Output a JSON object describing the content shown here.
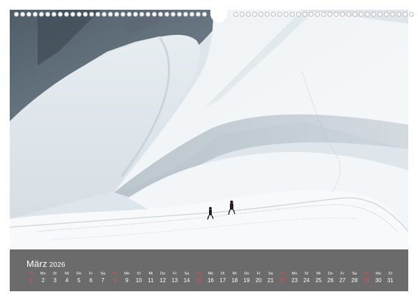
{
  "calendar": {
    "month": "März",
    "year": "2026",
    "days": [
      {
        "dow": "So",
        "num": "1",
        "sunday": true
      },
      {
        "dow": "Mo",
        "num": "2"
      },
      {
        "dow": "Di",
        "num": "3"
      },
      {
        "dow": "Mi",
        "num": "4"
      },
      {
        "dow": "Do",
        "num": "5"
      },
      {
        "dow": "Fr",
        "num": "6"
      },
      {
        "dow": "Sa",
        "num": "7"
      },
      {
        "dow": "So",
        "num": "8",
        "sunday": true
      },
      {
        "dow": "Mo",
        "num": "9"
      },
      {
        "dow": "Di",
        "num": "10"
      },
      {
        "dow": "Mi",
        "num": "11"
      },
      {
        "dow": "Do",
        "num": "12"
      },
      {
        "dow": "Fr",
        "num": "13"
      },
      {
        "dow": "Sa",
        "num": "14"
      },
      {
        "dow": "So",
        "num": "15",
        "sunday": true
      },
      {
        "dow": "Mo",
        "num": "16"
      },
      {
        "dow": "Di",
        "num": "17"
      },
      {
        "dow": "Mi",
        "num": "18"
      },
      {
        "dow": "Do",
        "num": "19"
      },
      {
        "dow": "Fr",
        "num": "20"
      },
      {
        "dow": "Sa",
        "num": "21"
      },
      {
        "dow": "So",
        "num": "22",
        "sunday": true
      },
      {
        "dow": "Mo",
        "num": "23"
      },
      {
        "dow": "Di",
        "num": "24"
      },
      {
        "dow": "Mi",
        "num": "25"
      },
      {
        "dow": "Do",
        "num": "26"
      },
      {
        "dow": "Fr",
        "num": "27"
      },
      {
        "dow": "Sa",
        "num": "28"
      },
      {
        "dow": "So",
        "num": "29",
        "sunday": true
      },
      {
        "dow": "Mo",
        "num": "30"
      },
      {
        "dow": "Di",
        "num": "31"
      }
    ]
  },
  "colors": {
    "footer": "#6b6b6b",
    "sunday": "#e54d4d",
    "text": "#ffffff"
  }
}
